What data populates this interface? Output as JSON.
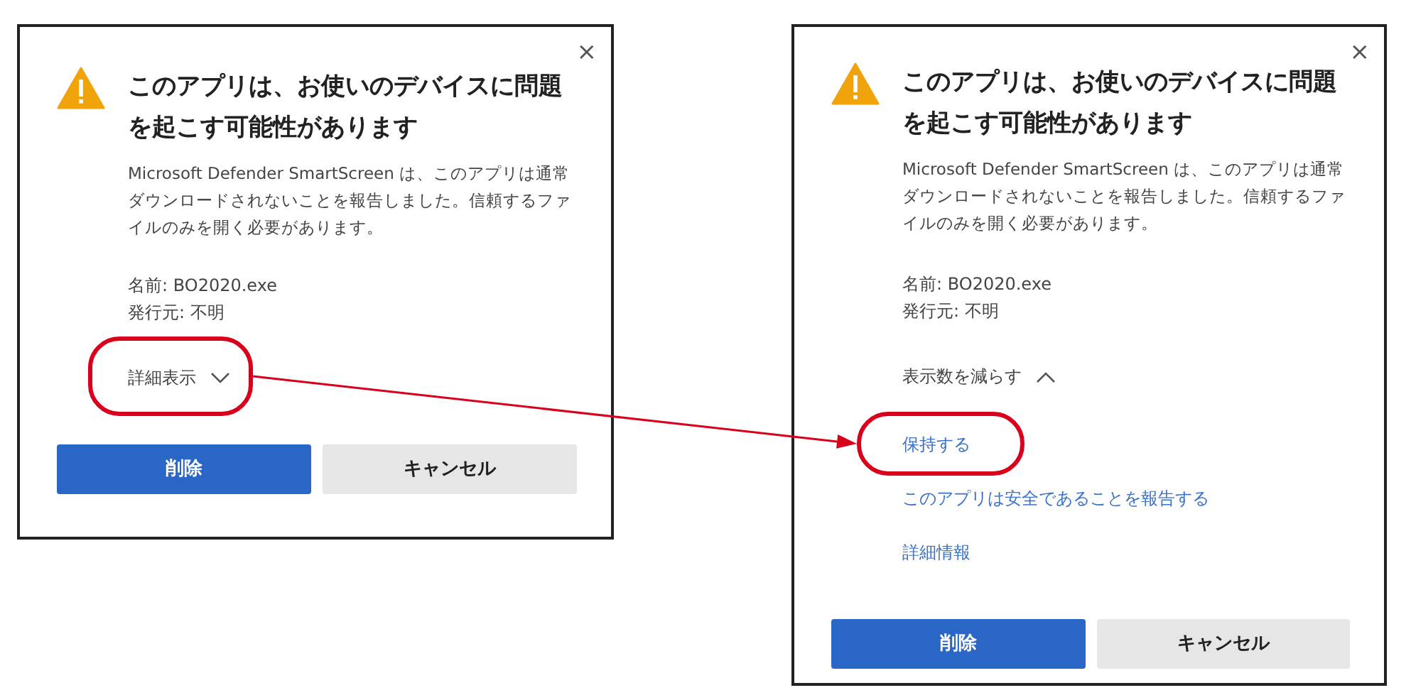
{
  "dialogs": [
    {
      "close": "×",
      "title": "このアプリは、お使いのデバイスに問題を起こす可能性があります",
      "description": "Microsoft Defender SmartScreen は、このアプリは通常ダウンロードされないことを報告しました。信頼するファイルのみを開く必要があります。",
      "details": [
        "名前: BO2020.exe",
        "発行元: 不明"
      ],
      "toggle": {
        "label": "詳細表示",
        "expanded": false,
        "highlighted": true
      },
      "buttons": [
        {
          "label": "削除",
          "kind": "primary"
        },
        {
          "label": "キャンセル",
          "kind": "secondary"
        }
      ]
    },
    {
      "close": "×",
      "title": "このアプリは、お使いのデバイスに問題を起こす可能性があります",
      "description": "Microsoft Defender SmartScreen は、このアプリは通常ダウンロードされないことを報告しました。信頼するファイルのみを開く必要があります。",
      "details": [
        "名前: BO2020.exe",
        "発行元: 不明"
      ],
      "toggle": {
        "label": "表示数を減らす",
        "expanded": true,
        "highlighted": false
      },
      "links": [
        {
          "label": "保持する",
          "highlighted": true
        },
        {
          "label": "このアプリは安全であることを報告する",
          "highlighted": false
        },
        {
          "label": "詳細情報",
          "highlighted": false
        }
      ],
      "buttons": [
        {
          "label": "削除",
          "kind": "primary"
        },
        {
          "label": "キャンセル",
          "kind": "secondary"
        }
      ]
    }
  ]
}
